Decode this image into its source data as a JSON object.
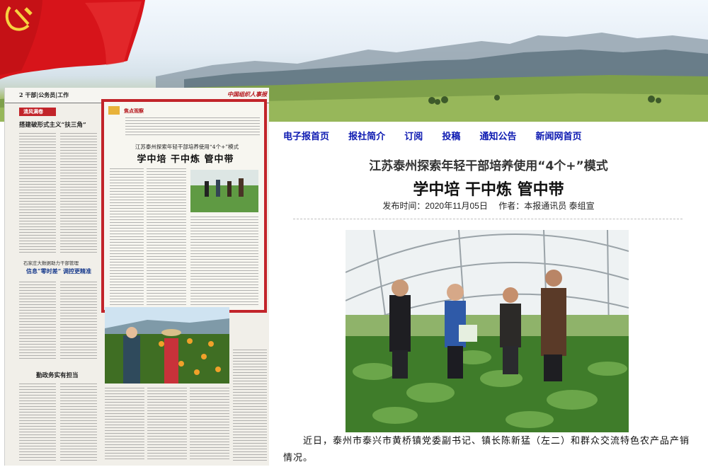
{
  "paper": {
    "section": "2 干部|公务员|工作",
    "masthead": "中国组织人事报",
    "left_headline_1": "搭建破形式主义“扶三角”",
    "left_column_label": "清风满卷",
    "left_headline_2": "信息“零时差” 调控更精准",
    "left_subhead_2": "石家庄大数据助力干部管理",
    "left_headline_3": "勤政务实有担当",
    "focus_label": "焦点观察",
    "focus_kicker": "江苏泰州探索年轻干部培养使用“4个+”模式",
    "focus_title": "学中培 干中炼 管中带"
  },
  "nav": {
    "items": [
      "电子报首页",
      "报社简介",
      "订阅",
      "投稿",
      "通知公告",
      "新闻网首页"
    ]
  },
  "article": {
    "kicker": "江苏泰州探索年轻干部培养使用“4个+”模式",
    "headline": "学中培 干中炼 管中带",
    "publish_time": "发布时间：2020年11月05日",
    "author": "作者：本报通讯员 泰组宣",
    "caption": "近日，泰州市泰兴市黄桥镇党委副书记、镇长陈新猛（左二）和群众交流特色农产品产销情况。"
  },
  "colors": {
    "nav_link": "#0d1ab1",
    "focus_border": "#c2242a",
    "flag_red": "#d7141a"
  }
}
